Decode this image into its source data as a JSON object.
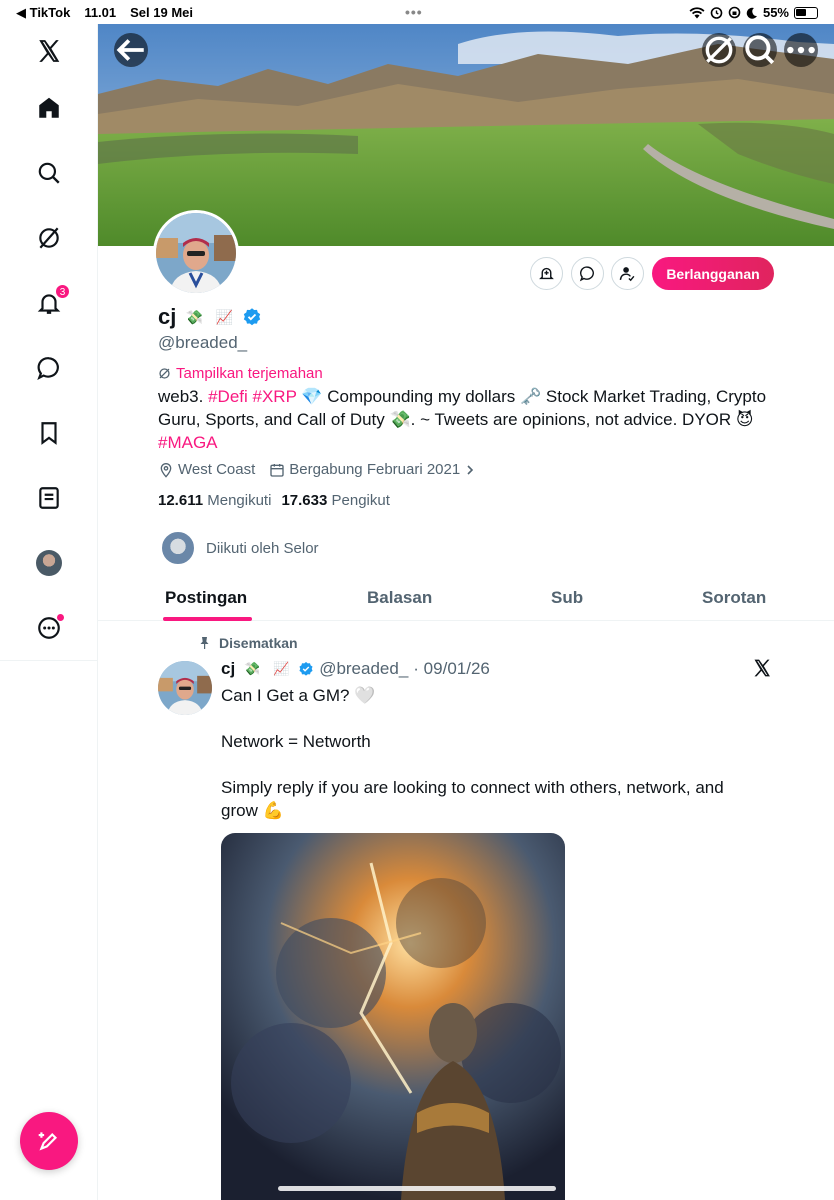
{
  "status_bar": {
    "back_app": "◀ TikTok",
    "time": "11.01",
    "date": "Sel 19 Mei",
    "battery": "55%",
    "battery_level": 0.55
  },
  "sidebar": {
    "notifications_badge": "3"
  },
  "profile": {
    "name": "cj",
    "handle": "@breaded_",
    "subscribe_label": "Berlangganan",
    "translate_label": "Tampilkan terjemahan",
    "bio": {
      "p1": "web3. ",
      "tag1": "#Defi",
      "tag2": "#XRP",
      "p2": " 💎 Compounding my dollars 🗝️ Stock Market Trading, Crypto Guru, Sports, and Call of Duty 💸. ~ Tweets are opinions, not advice. DYOR 😈 ",
      "tag3": "#MAGA"
    },
    "location": "West Coast",
    "joined": "Bergabung Februari 2021",
    "following_count": "12.611",
    "following_label": "Mengikuti",
    "followers_count": "17.633",
    "followers_label": "Pengikut",
    "followed_by": "Diikuti oleh Selor"
  },
  "tabs": [
    {
      "label": "Postingan",
      "active": true
    },
    {
      "label": "Balasan",
      "active": false
    },
    {
      "label": "Sub",
      "active": false
    },
    {
      "label": "Sorotan",
      "active": false
    }
  ],
  "pinned_tweet": {
    "pinned_label": "Disematkan",
    "name": "cj",
    "handle": "@breaded_",
    "date": "· 09/01/26",
    "text": "Can I Get a GM? 🤍\n\nNetwork = Networth\n\nSimply reply if you are looking to connect with others, network, and grow 💪"
  },
  "colors": {
    "accent": "#f91880",
    "verified": "#1d9bf0",
    "muted": "#536471"
  }
}
